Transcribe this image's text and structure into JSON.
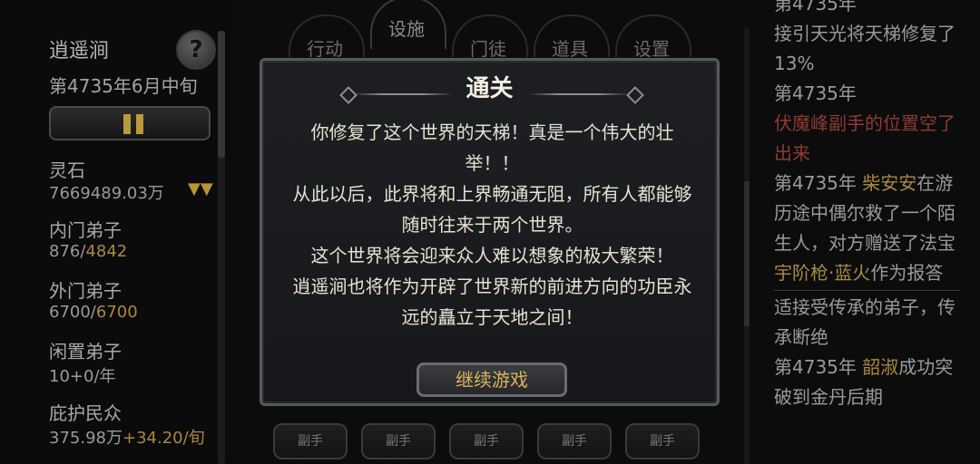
{
  "left": {
    "sect_name": "逍遥涧",
    "date": "第4735年6月中旬",
    "help_icon": "?",
    "stats": [
      {
        "label": "灵石",
        "value": "7669489.03万",
        "gold": ""
      },
      {
        "label": "内门弟子",
        "value": "876/",
        "gold": "4842"
      },
      {
        "label": "外门弟子",
        "value": "6700/",
        "gold": "6700"
      },
      {
        "label": "闲置弟子",
        "value": "10+0/年",
        "gold": ""
      },
      {
        "label": "庇护民众",
        "value": "375.98万",
        "gold": "+34.20/旬"
      }
    ],
    "expand_icon": "▼▼"
  },
  "nav": {
    "tabs": [
      "行动",
      "设施",
      "门徒",
      "道具",
      "设置"
    ],
    "active": "设施"
  },
  "log": [
    {
      "parts": [
        {
          "t": "第4735年",
          "c": ""
        }
      ]
    },
    {
      "parts": [
        {
          "t": "接引天光将天梯修复了13%",
          "c": ""
        }
      ]
    },
    {
      "parts": [
        {
          "t": "第4735年",
          "c": ""
        }
      ]
    },
    {
      "parts": [
        {
          "t": "伏魔峰副手的位置空了出来",
          "c": "red"
        }
      ]
    },
    {
      "parts": [
        {
          "t": "第4735年 ",
          "c": ""
        },
        {
          "t": "柴安安",
          "c": "gold"
        },
        {
          "t": "在游历途中偶尔救了一个陌生人，对方赠送了法宝",
          "c": ""
        },
        {
          "t": "宇阶枪·蓝火",
          "c": "gold"
        },
        {
          "t": "作为报答",
          "c": ""
        }
      ]
    },
    {
      "sep": true
    },
    {
      "parts": [
        {
          "t": "适接受传承的弟子，传承断绝",
          "c": ""
        }
      ]
    },
    {
      "parts": [
        {
          "t": "第4735年 ",
          "c": ""
        },
        {
          "t": "韶淑",
          "c": "gold"
        },
        {
          "t": "成功突破到金丹后期",
          "c": ""
        }
      ]
    }
  ],
  "slots": [
    "副手",
    "副手",
    "副手",
    "副手",
    "副手"
  ],
  "modal": {
    "title": "通关",
    "paragraphs": [
      "你修复了这个世界的天梯！真是一个伟大的壮举！！",
      "从此以后，此界将和上界畅通无阻，所有人都能够随时往来于两个世界。",
      "这个世界将会迎来众人难以想象的极大繁荣！",
      "逍遥涧也将作为开辟了世界新的前进方向的功臣永远的矗立于天地之间！"
    ],
    "continue_label": "继续游戏"
  },
  "colors": {
    "gold": "#a8893f",
    "red": "#8e3a32",
    "button_text": "#d9b55d"
  }
}
